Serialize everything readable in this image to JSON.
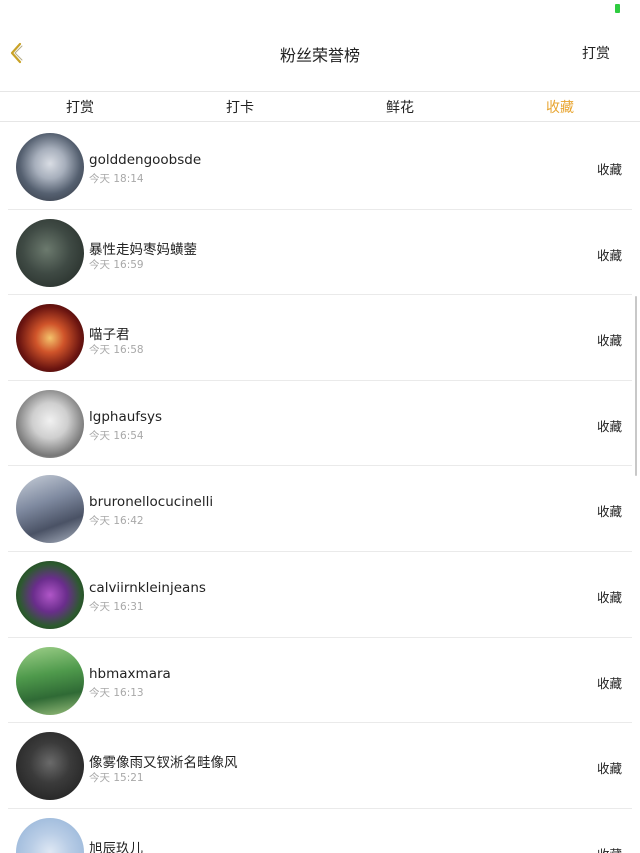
{
  "nav": {
    "title": "粉丝荣誉榜",
    "action_label": "打赏",
    "back_icon": "chevron-left-icon",
    "accent_color": "#e8a531"
  },
  "tabs": [
    {
      "label": "打赏"
    },
    {
      "label": "打卡"
    },
    {
      "label": "鲜花"
    },
    {
      "label": "收藏"
    }
  ],
  "active_tab": "收藏",
  "items": [
    {
      "name": "golddengoobsde",
      "time": "今天 18:14",
      "action": "收藏"
    },
    {
      "name": "暴性走妈枣妈蟥蓥",
      "time": "今天 16:59",
      "action": "收藏"
    },
    {
      "name": "喵子君",
      "time": "今天 16:58",
      "action": "收藏"
    },
    {
      "name": "lgphaufsys",
      "time": "今天 16:54",
      "action": "收藏"
    },
    {
      "name": "bruronellocucinelli",
      "time": "今天 16:42",
      "action": "收藏"
    },
    {
      "name": "calviirnkleinjeans",
      "time": "今天 16:31",
      "action": "收藏"
    },
    {
      "name": "hbmaxmara",
      "time": "今天 16:13",
      "action": "收藏"
    },
    {
      "name": "像雾像雨又钗淅名畦像风",
      "time": "今天 15:21",
      "action": "收藏"
    },
    {
      "name": "旭辰玖儿",
      "time": "",
      "action": "收藏"
    }
  ]
}
